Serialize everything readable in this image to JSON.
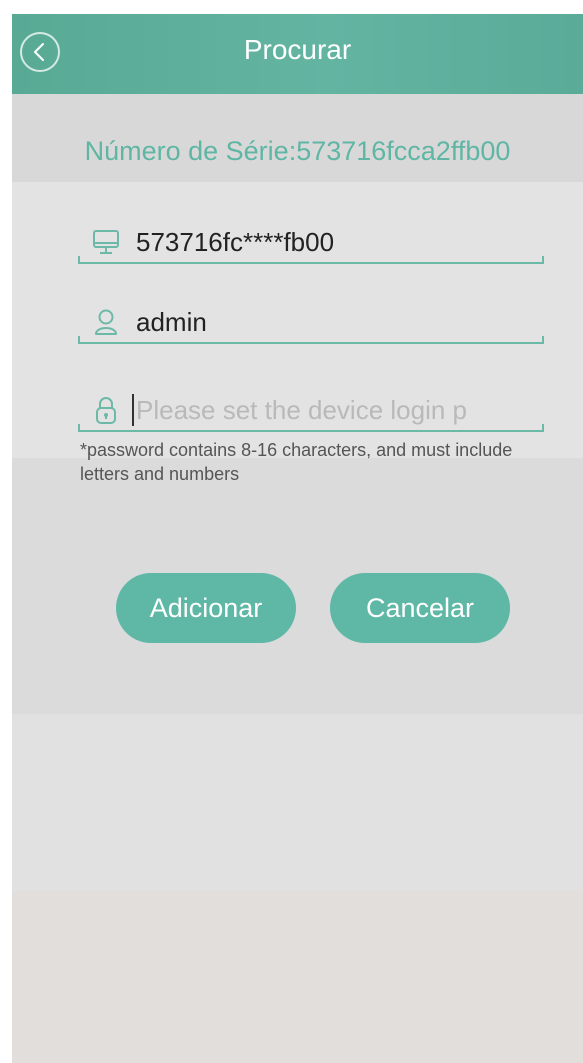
{
  "header": {
    "title": "Procurar",
    "back_icon": "chevron-left-icon"
  },
  "device": {
    "serial_label": "Número de Série:573716fcca2ffb00"
  },
  "form": {
    "device_field": {
      "icon": "monitor-icon",
      "value": "573716fc****fb00"
    },
    "username_field": {
      "icon": "user-icon",
      "value": "admin"
    },
    "password_field": {
      "icon": "lock-icon",
      "value": "",
      "placeholder": "Please set the device login p"
    },
    "hint": "*password contains 8-16 characters, and must include letters and numbers"
  },
  "actions": {
    "add_label": "Adicionar",
    "cancel_label": "Cancelar"
  },
  "colors": {
    "accent": "#5fb8a6",
    "header": "#5fae9b",
    "background": "#dcdcdc"
  }
}
